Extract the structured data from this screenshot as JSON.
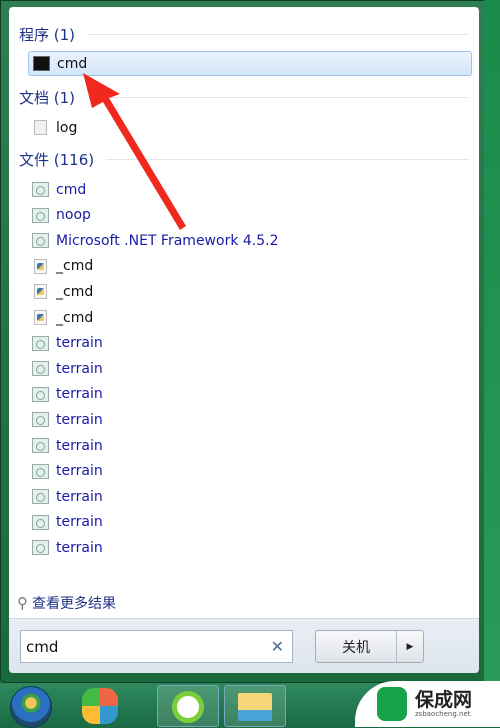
{
  "sections": {
    "programs": {
      "header": "程序 (1)",
      "items": [
        {
          "label": "cmd",
          "icon": "cmd-icon"
        }
      ]
    },
    "documents": {
      "header": "文档 (1)",
      "items": [
        {
          "label": "log",
          "icon": "document-icon"
        }
      ]
    },
    "files": {
      "header": "文件 (116)",
      "items": [
        {
          "label": "cmd",
          "icon": "image-file-icon"
        },
        {
          "label": "noop",
          "icon": "image-file-icon"
        },
        {
          "label": "Microsoft .NET Framework 4.5.2",
          "icon": "image-file-icon"
        },
        {
          "label": "_cmd",
          "icon": "python-file-icon"
        },
        {
          "label": "_cmd",
          "icon": "python-file-icon"
        },
        {
          "label": "_cmd",
          "icon": "python-file-icon"
        },
        {
          "label": "terrain",
          "icon": "image-file-icon"
        },
        {
          "label": "terrain",
          "icon": "image-file-icon"
        },
        {
          "label": "terrain",
          "icon": "image-file-icon"
        },
        {
          "label": "terrain",
          "icon": "image-file-icon"
        },
        {
          "label": "terrain",
          "icon": "image-file-icon"
        },
        {
          "label": "terrain",
          "icon": "image-file-icon"
        },
        {
          "label": "terrain",
          "icon": "image-file-icon"
        },
        {
          "label": "terrain",
          "icon": "image-file-icon"
        },
        {
          "label": "terrain",
          "icon": "image-file-icon"
        }
      ]
    }
  },
  "see_more": "查看更多结果",
  "search": {
    "value": "cmd"
  },
  "shutdown_label": "关机",
  "watermark": {
    "title": "保成网",
    "url": "zsbaocheng.net"
  },
  "colors": {
    "header": "#1e3287",
    "link": "#1a1aa8",
    "arrow": "#f0281e"
  }
}
